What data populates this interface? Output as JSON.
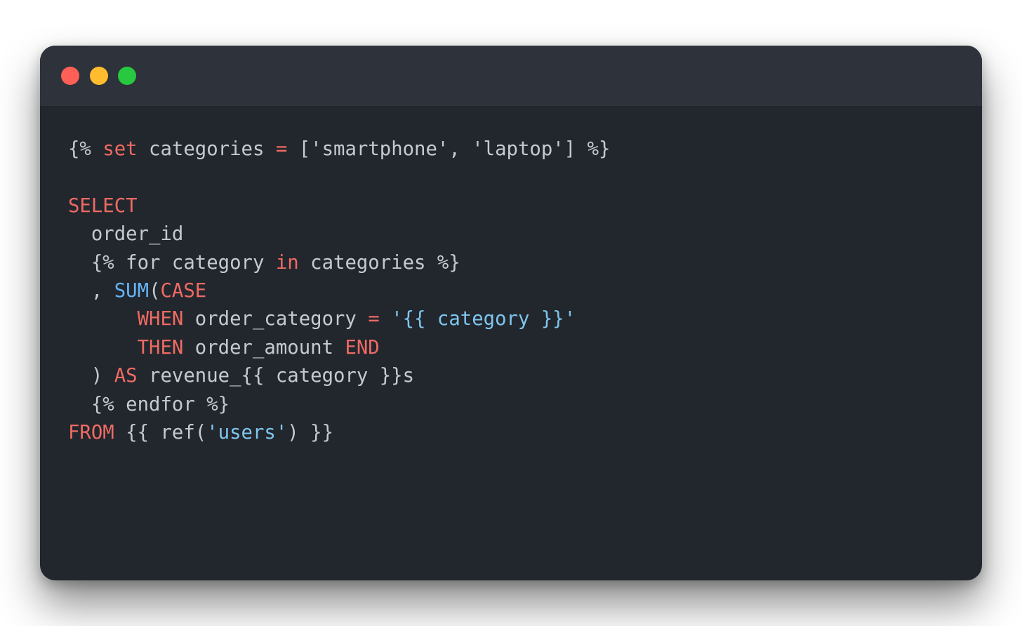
{
  "window": {
    "controls": [
      {
        "name": "close",
        "color": "#fe5f57"
      },
      {
        "name": "minimize",
        "color": "#febc2e"
      },
      {
        "name": "maximize",
        "color": "#28c840"
      }
    ]
  },
  "colors": {
    "keyword": "#ef6b63",
    "function": "#65b5f6",
    "string": "#7fc6ee",
    "text": "#c5c9d0",
    "background": "#22262d",
    "titlebar": "#2e323a"
  },
  "code": {
    "lines": [
      [
        {
          "t": "{% ",
          "k": "txt"
        },
        {
          "t": "set",
          "k": "kw"
        },
        {
          "t": " categories ",
          "k": "txt"
        },
        {
          "t": "=",
          "k": "kw"
        },
        {
          "t": " ['smartphone', 'laptop'] %}",
          "k": "txt"
        }
      ],
      [],
      [
        {
          "t": "SELECT",
          "k": "kw"
        }
      ],
      [
        {
          "t": "  order_id",
          "k": "txt"
        }
      ],
      [
        {
          "t": "  {% for category ",
          "k": "txt"
        },
        {
          "t": "in",
          "k": "kw"
        },
        {
          "t": " categories %}",
          "k": "txt"
        }
      ],
      [
        {
          "t": "  , ",
          "k": "txt"
        },
        {
          "t": "SUM",
          "k": "fn"
        },
        {
          "t": "(",
          "k": "txt"
        },
        {
          "t": "CASE",
          "k": "kw"
        }
      ],
      [
        {
          "t": "      ",
          "k": "txt"
        },
        {
          "t": "WHEN",
          "k": "kw"
        },
        {
          "t": " order_category ",
          "k": "txt"
        },
        {
          "t": "=",
          "k": "kw"
        },
        {
          "t": " ",
          "k": "txt"
        },
        {
          "t": "'{{ category }}'",
          "k": "str"
        }
      ],
      [
        {
          "t": "      ",
          "k": "txt"
        },
        {
          "t": "THEN",
          "k": "kw"
        },
        {
          "t": " order_amount ",
          "k": "txt"
        },
        {
          "t": "END",
          "k": "kw"
        }
      ],
      [
        {
          "t": "  ) ",
          "k": "txt"
        },
        {
          "t": "AS",
          "k": "kw"
        },
        {
          "t": " revenue_{{ category }}s",
          "k": "txt"
        }
      ],
      [
        {
          "t": "  {% endfor %}",
          "k": "txt"
        }
      ],
      [
        {
          "t": "FROM",
          "k": "kw"
        },
        {
          "t": " {{ ref(",
          "k": "txt"
        },
        {
          "t": "'users'",
          "k": "str"
        },
        {
          "t": ") }}",
          "k": "txt"
        }
      ]
    ]
  }
}
